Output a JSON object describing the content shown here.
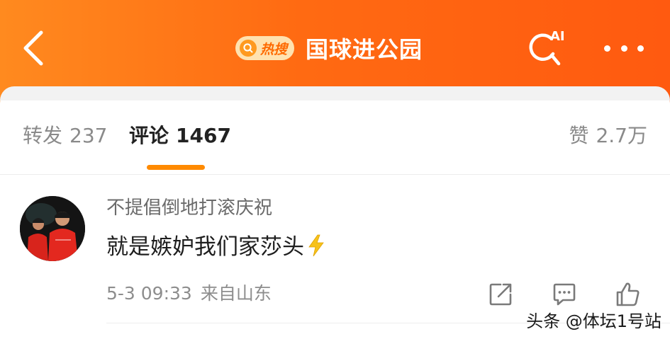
{
  "header": {
    "hot_badge_label": "热搜",
    "topic_title": "国球进公园",
    "ai_label": "AI",
    "back_icon": "chevron-left-icon",
    "ai_icon": "ai-search-icon",
    "more_icon": "more-dots-icon",
    "accent_color": "#ff6a12",
    "badge_bg_color": "#ffe2b0"
  },
  "tabs": {
    "repost": {
      "label": "转发",
      "count": "237"
    },
    "comment": {
      "label": "评论",
      "count": "1467",
      "active": true
    },
    "like": {
      "label": "赞",
      "count": "2.7万"
    },
    "indicator_color": "#ff8a00"
  },
  "comment": {
    "username": "不提倡倒地打滚庆祝",
    "text": "就是嫉妒我们家莎头",
    "emoji": "lightning-icon",
    "timestamp": "5-3 09:33",
    "location": "来自山东",
    "actions": [
      "share-icon",
      "reply-icon",
      "like-icon"
    ]
  },
  "watermark": "头条 @体坛1号站"
}
